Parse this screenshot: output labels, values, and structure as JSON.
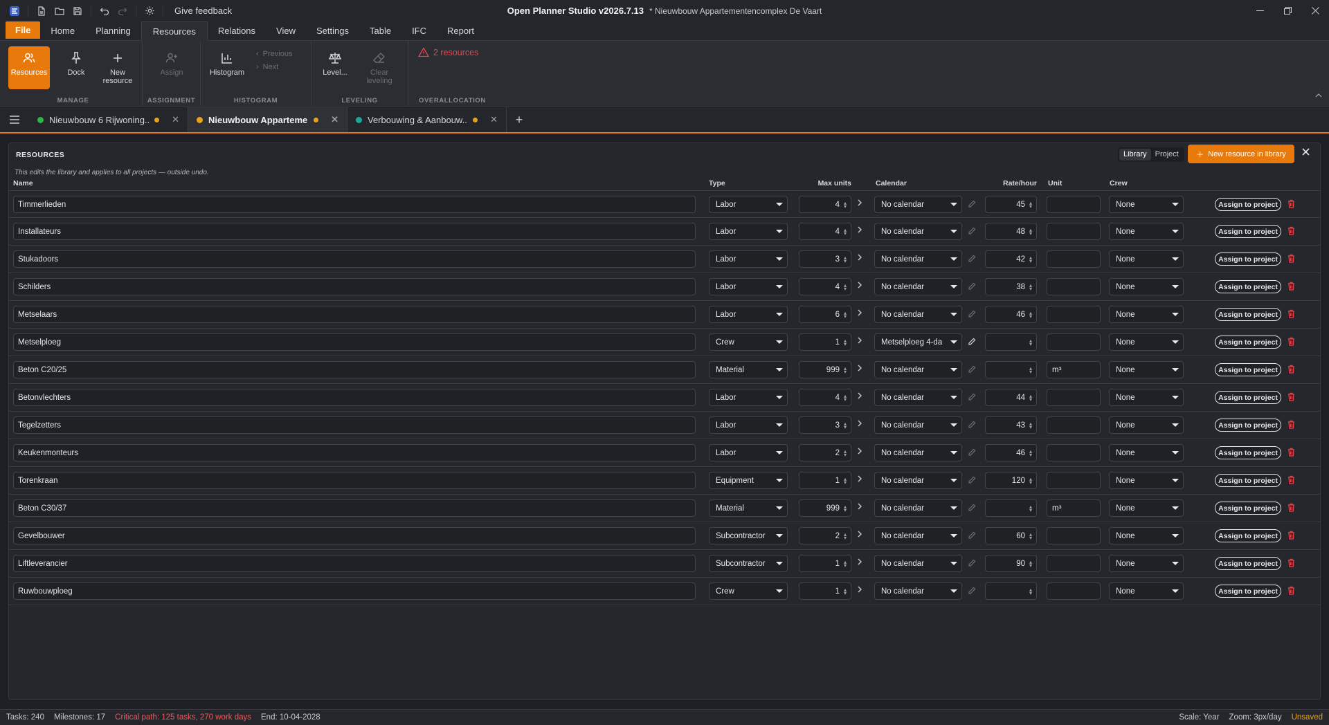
{
  "titlebar": {
    "app_title": "Open Planner Studio v2026.7.13",
    "document_title": "* Nieuwbouw Appartementencomplex De Vaart",
    "feedback": "Give feedback"
  },
  "menu": {
    "file": "File",
    "tabs": [
      "Home",
      "Planning",
      "Resources",
      "Relations",
      "View",
      "Settings",
      "Table",
      "IFC",
      "Report"
    ],
    "active": "Resources"
  },
  "ribbon": {
    "manage": {
      "label": "MANAGE",
      "resources": "Resources",
      "dock": "Dock",
      "new_resource": "New resource"
    },
    "assignment": {
      "label": "ASSIGNMENT",
      "assign": "Assign"
    },
    "histogram": {
      "label": "HISTOGRAM",
      "histogram": "Histogram",
      "previous": "Previous",
      "next": "Next"
    },
    "leveling": {
      "label": "LEVELING",
      "level": "Level...",
      "clear": "Clear leveling"
    },
    "overallocation": {
      "label": "OVERALLOCATION",
      "warning": "2 resources"
    }
  },
  "doc_tabs": [
    {
      "label": "Nieuwbouw 6 Rijwoning...",
      "dot_color": "#2fb344"
    },
    {
      "label": "Nieuwbouw Appartemen...",
      "dot_color": "#e8a317"
    },
    {
      "label": "Verbouwing & Aanbouw...",
      "dot_color": "#1fa59a"
    }
  ],
  "panel": {
    "title": "RESOURCES",
    "seg_library": "Library",
    "seg_project": "Project",
    "new_button": "New resource in library",
    "note": "This edits the library and applies to all projects — outside undo.",
    "headers": {
      "name": "Name",
      "type": "Type",
      "max_units": "Max units",
      "calendar": "Calendar",
      "rate": "Rate/hour",
      "unit": "Unit",
      "crew": "Crew"
    },
    "assign_label": "Assign to project"
  },
  "resources": [
    {
      "name": "Timmerlieden",
      "type": "Labor",
      "max": "4",
      "calendar": "No calendar",
      "rate": "45",
      "unit": "",
      "crew": "None"
    },
    {
      "name": "Installateurs",
      "type": "Labor",
      "max": "4",
      "calendar": "No calendar",
      "rate": "48",
      "unit": "",
      "crew": "None"
    },
    {
      "name": "Stukadoors",
      "type": "Labor",
      "max": "3",
      "calendar": "No calendar",
      "rate": "42",
      "unit": "",
      "crew": "None"
    },
    {
      "name": "Schilders",
      "type": "Labor",
      "max": "4",
      "calendar": "No calendar",
      "rate": "38",
      "unit": "",
      "crew": "None"
    },
    {
      "name": "Metselaars",
      "type": "Labor",
      "max": "6",
      "calendar": "No calendar",
      "rate": "46",
      "unit": "",
      "crew": "None"
    },
    {
      "name": "Metselploeg",
      "type": "Crew",
      "max": "1",
      "calendar": "Metselploeg 4-da",
      "rate": "",
      "unit": "",
      "crew": "None"
    },
    {
      "name": "Beton C20/25",
      "type": "Material",
      "max": "999",
      "calendar": "No calendar",
      "rate": "",
      "unit": "m³",
      "crew": "None"
    },
    {
      "name": "Betonvlechters",
      "type": "Labor",
      "max": "4",
      "calendar": "No calendar",
      "rate": "44",
      "unit": "",
      "crew": "None"
    },
    {
      "name": "Tegelzetters",
      "type": "Labor",
      "max": "3",
      "calendar": "No calendar",
      "rate": "43",
      "unit": "",
      "crew": "None"
    },
    {
      "name": "Keukenmonteurs",
      "type": "Labor",
      "max": "2",
      "calendar": "No calendar",
      "rate": "46",
      "unit": "",
      "crew": "None"
    },
    {
      "name": "Torenkraan",
      "type": "Equipment",
      "max": "1",
      "calendar": "No calendar",
      "rate": "120",
      "unit": "",
      "crew": "None"
    },
    {
      "name": "Beton C30/37",
      "type": "Material",
      "max": "999",
      "calendar": "No calendar",
      "rate": "",
      "unit": "m³",
      "crew": "None"
    },
    {
      "name": "Gevelbouwer",
      "type": "Subcontractor",
      "max": "2",
      "calendar": "No calendar",
      "rate": "60",
      "unit": "",
      "crew": "None"
    },
    {
      "name": "Liftleverancier",
      "type": "Subcontractor",
      "max": "1",
      "calendar": "No calendar",
      "rate": "90",
      "unit": "",
      "crew": "None"
    },
    {
      "name": "Ruwbouwploeg",
      "type": "Crew",
      "max": "1",
      "calendar": "No calendar",
      "rate": "",
      "unit": "",
      "crew": "None"
    }
  ],
  "status": {
    "tasks": "Tasks: 240",
    "milestones": "Milestones: 17",
    "critical": "Critical path: 125 tasks, 270 work days",
    "end": "End: 10-04-2028",
    "scale": "Scale: Year",
    "zoom": "Zoom: 3px/day",
    "unsaved": "Unsaved"
  },
  "colors": {
    "accent": "#e87a0c",
    "danger": "#e5484d"
  }
}
